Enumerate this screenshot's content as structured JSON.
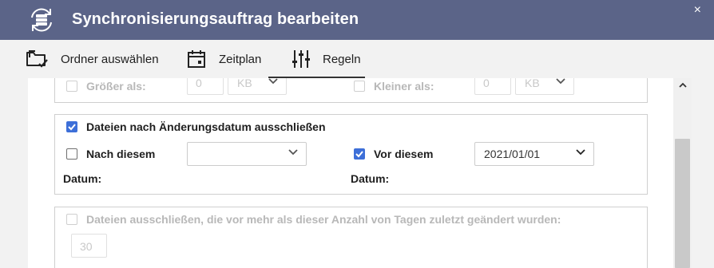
{
  "window": {
    "title": "Synchronisierungsauftrag bearbeiten",
    "close_label": "×"
  },
  "tabs": [
    {
      "label": "Ordner auswählen",
      "icon": "folder-check-icon",
      "active": false
    },
    {
      "label": "Zeitplan",
      "icon": "calendar-icon",
      "active": false
    },
    {
      "label": "Regeln",
      "icon": "sliders-icon",
      "active": true
    }
  ],
  "size_filter": {
    "greater_label": "Größer als:",
    "greater_value": "0",
    "greater_unit": "KB",
    "smaller_label": "Kleiner als:",
    "smaller_value": "0",
    "smaller_unit": "KB",
    "enabled": false
  },
  "date_filter": {
    "header_label": "Dateien nach Änderungsdatum ausschließen",
    "header_checked": true,
    "after_label": "Nach diesem",
    "after_sub": "Datum:",
    "after_checked": false,
    "after_value": "",
    "before_label": "Vor diesem",
    "before_sub": "Datum:",
    "before_checked": true,
    "before_value": "2021/01/01"
  },
  "days_filter": {
    "label": "Dateien ausschließen, die vor mehr als dieser Anzahl von Tagen zuletzt geändert wurden:",
    "value": "30",
    "enabled": false
  },
  "colors": {
    "titlebar": "#5b6488",
    "accent": "#3d6fd8"
  }
}
